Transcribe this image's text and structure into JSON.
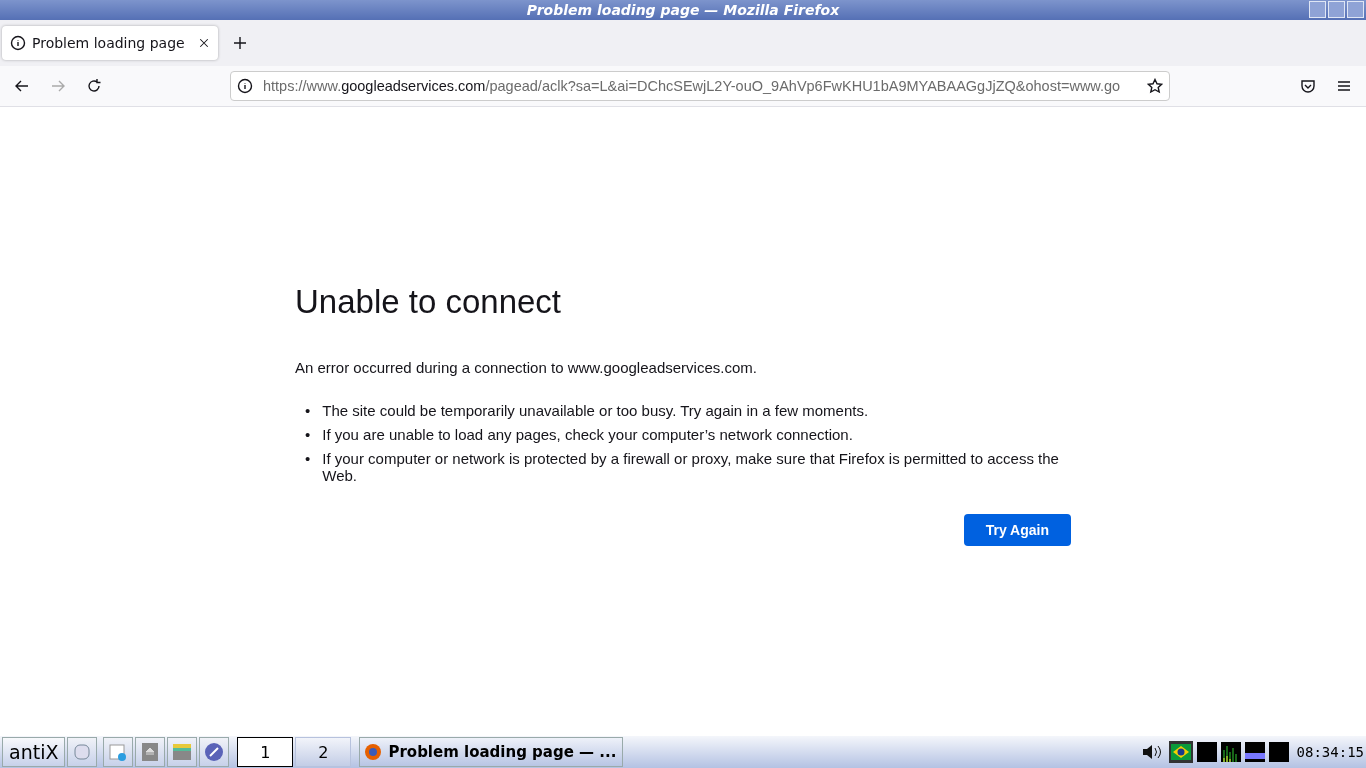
{
  "window": {
    "title": "Problem loading page — Mozilla Firefox"
  },
  "tabs": [
    {
      "label": "Problem loading page",
      "selected": true
    }
  ],
  "address_bar": {
    "scheme": "https://www.",
    "host": "googleadservices.com",
    "path": "/pagead/aclk?sa=L&ai=DChcSEwjL2Y-ouO_9AhVp6FwKHU1bA9MYABAAGgJjZQ&ohost=www.go"
  },
  "error_page": {
    "title": "Unable to connect",
    "message": "An error occurred during a connection to www.googleadservices.com.",
    "tips": [
      "The site could be temporarily unavailable or too busy. Try again in a few moments.",
      "If you are unable to load any pages, check your computer’s network connection.",
      "If your computer or network is protected by a firewall or proxy, make sure that Firefox is permitted to access the Web."
    ],
    "bullet": "•",
    "button": "Try Again"
  },
  "taskbar": {
    "menu": "antiX",
    "workspaces": [
      {
        "label": "1",
        "selected": true
      },
      {
        "label": "2",
        "selected": false
      }
    ],
    "task": "Problem loading page — ...",
    "clock": "08:34:15"
  }
}
